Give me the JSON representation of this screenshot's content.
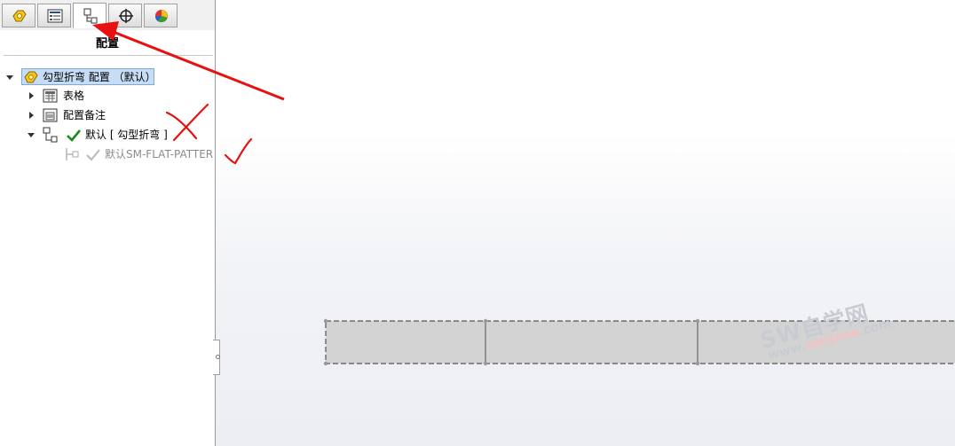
{
  "panel": {
    "title": "配置",
    "tabs": [
      {
        "name": "FeatureManager",
        "icon": "feature-tree-icon"
      },
      {
        "name": "PropertyManager",
        "icon": "property-manager-icon"
      },
      {
        "name": "ConfigurationManager",
        "icon": "configuration-manager-icon",
        "active": true
      },
      {
        "name": "DimXpertManager",
        "icon": "dimxpert-icon"
      },
      {
        "name": "DisplayManager",
        "icon": "display-manager-icon"
      }
    ],
    "tree": {
      "root": "勾型折弯 配置 （默认）",
      "tables": "表格",
      "notes": "配置备注",
      "default_config": "默认 [ 勾型折弯 ]",
      "flat_pattern": "默认SM-FLAT-PATTERN"
    }
  },
  "watermark": {
    "main": "SW自学网",
    "url_prefix": "www.",
    "url_domain": "swrjzxw",
    "url_suffix": ".com"
  },
  "colors": {
    "selection": "#c6ddf5",
    "check_active": "#1a8a1a",
    "annotation_red": "#e81010",
    "part_fill": "#d3d3d3"
  }
}
